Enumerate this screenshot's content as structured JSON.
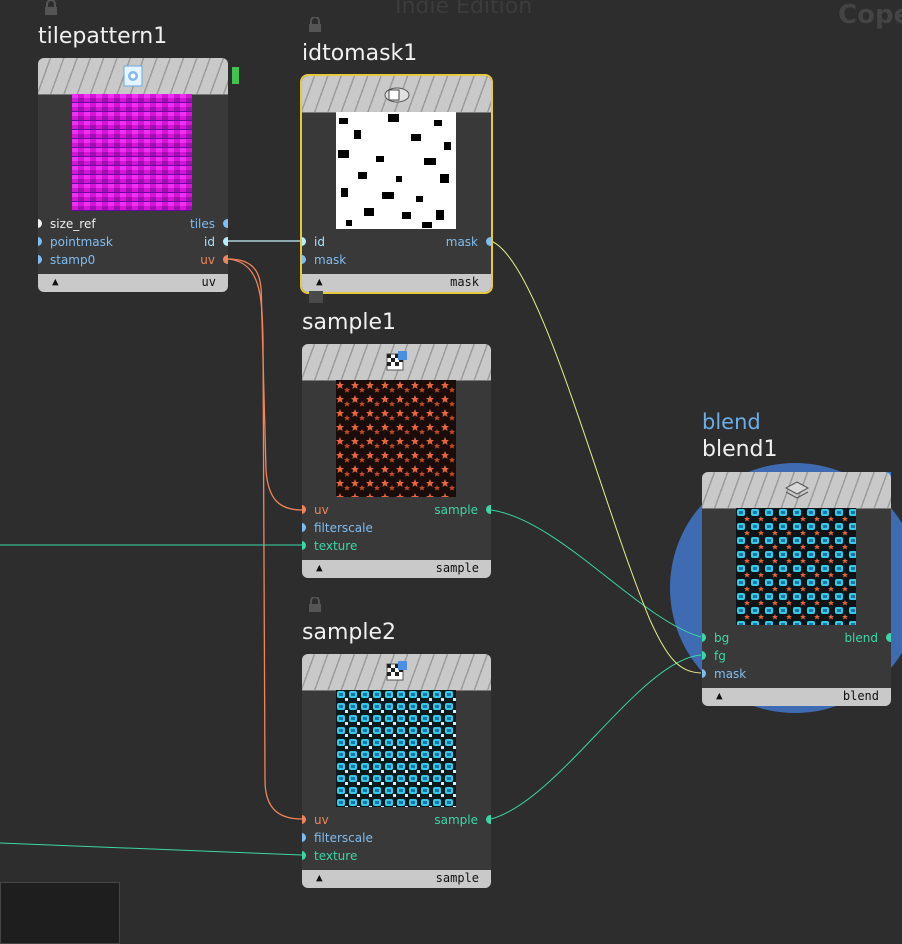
{
  "watermark": "Indie Edition",
  "watermark_right": "Cope",
  "nodes": {
    "tilepattern": {
      "title": "tilepattern1",
      "footer": "uv",
      "inputs": [
        "size_ref",
        "pointmask",
        "stamp0"
      ],
      "outputs": [
        "tiles",
        "id",
        "uv"
      ]
    },
    "idtomask": {
      "title": "idtomask1",
      "footer": "mask",
      "inputs": [
        "id",
        "mask"
      ],
      "outputs": [
        "mask"
      ]
    },
    "sample1": {
      "title": "sample1",
      "footer": "sample",
      "inputs": [
        "uv",
        "filterscale",
        "texture"
      ],
      "outputs": [
        "sample"
      ]
    },
    "sample2": {
      "title": "sample2",
      "footer": "sample",
      "inputs": [
        "uv",
        "filterscale",
        "texture"
      ],
      "outputs": [
        "sample"
      ]
    },
    "blend": {
      "subtitle": "blend",
      "title": "blend1",
      "footer": "blend",
      "inputs": [
        "bg",
        "fg",
        "mask"
      ],
      "outputs": [
        "blend"
      ]
    }
  },
  "colors": {
    "background": "#2d2d2d",
    "node_body": "#393939",
    "header": "#c9c9c9",
    "selection": "#e6c93c",
    "port_blue": "#7fbdf2",
    "port_orange": "#f0855c",
    "port_green": "#3dd6a6",
    "blend_highlight": "#3f6bb3"
  },
  "icons": {
    "tilepattern": "tile-pattern-icon",
    "idtomask": "id-to-mask-icon",
    "sample": "sample-icon",
    "blend": "layers-icon",
    "lock": "lock-icon"
  }
}
